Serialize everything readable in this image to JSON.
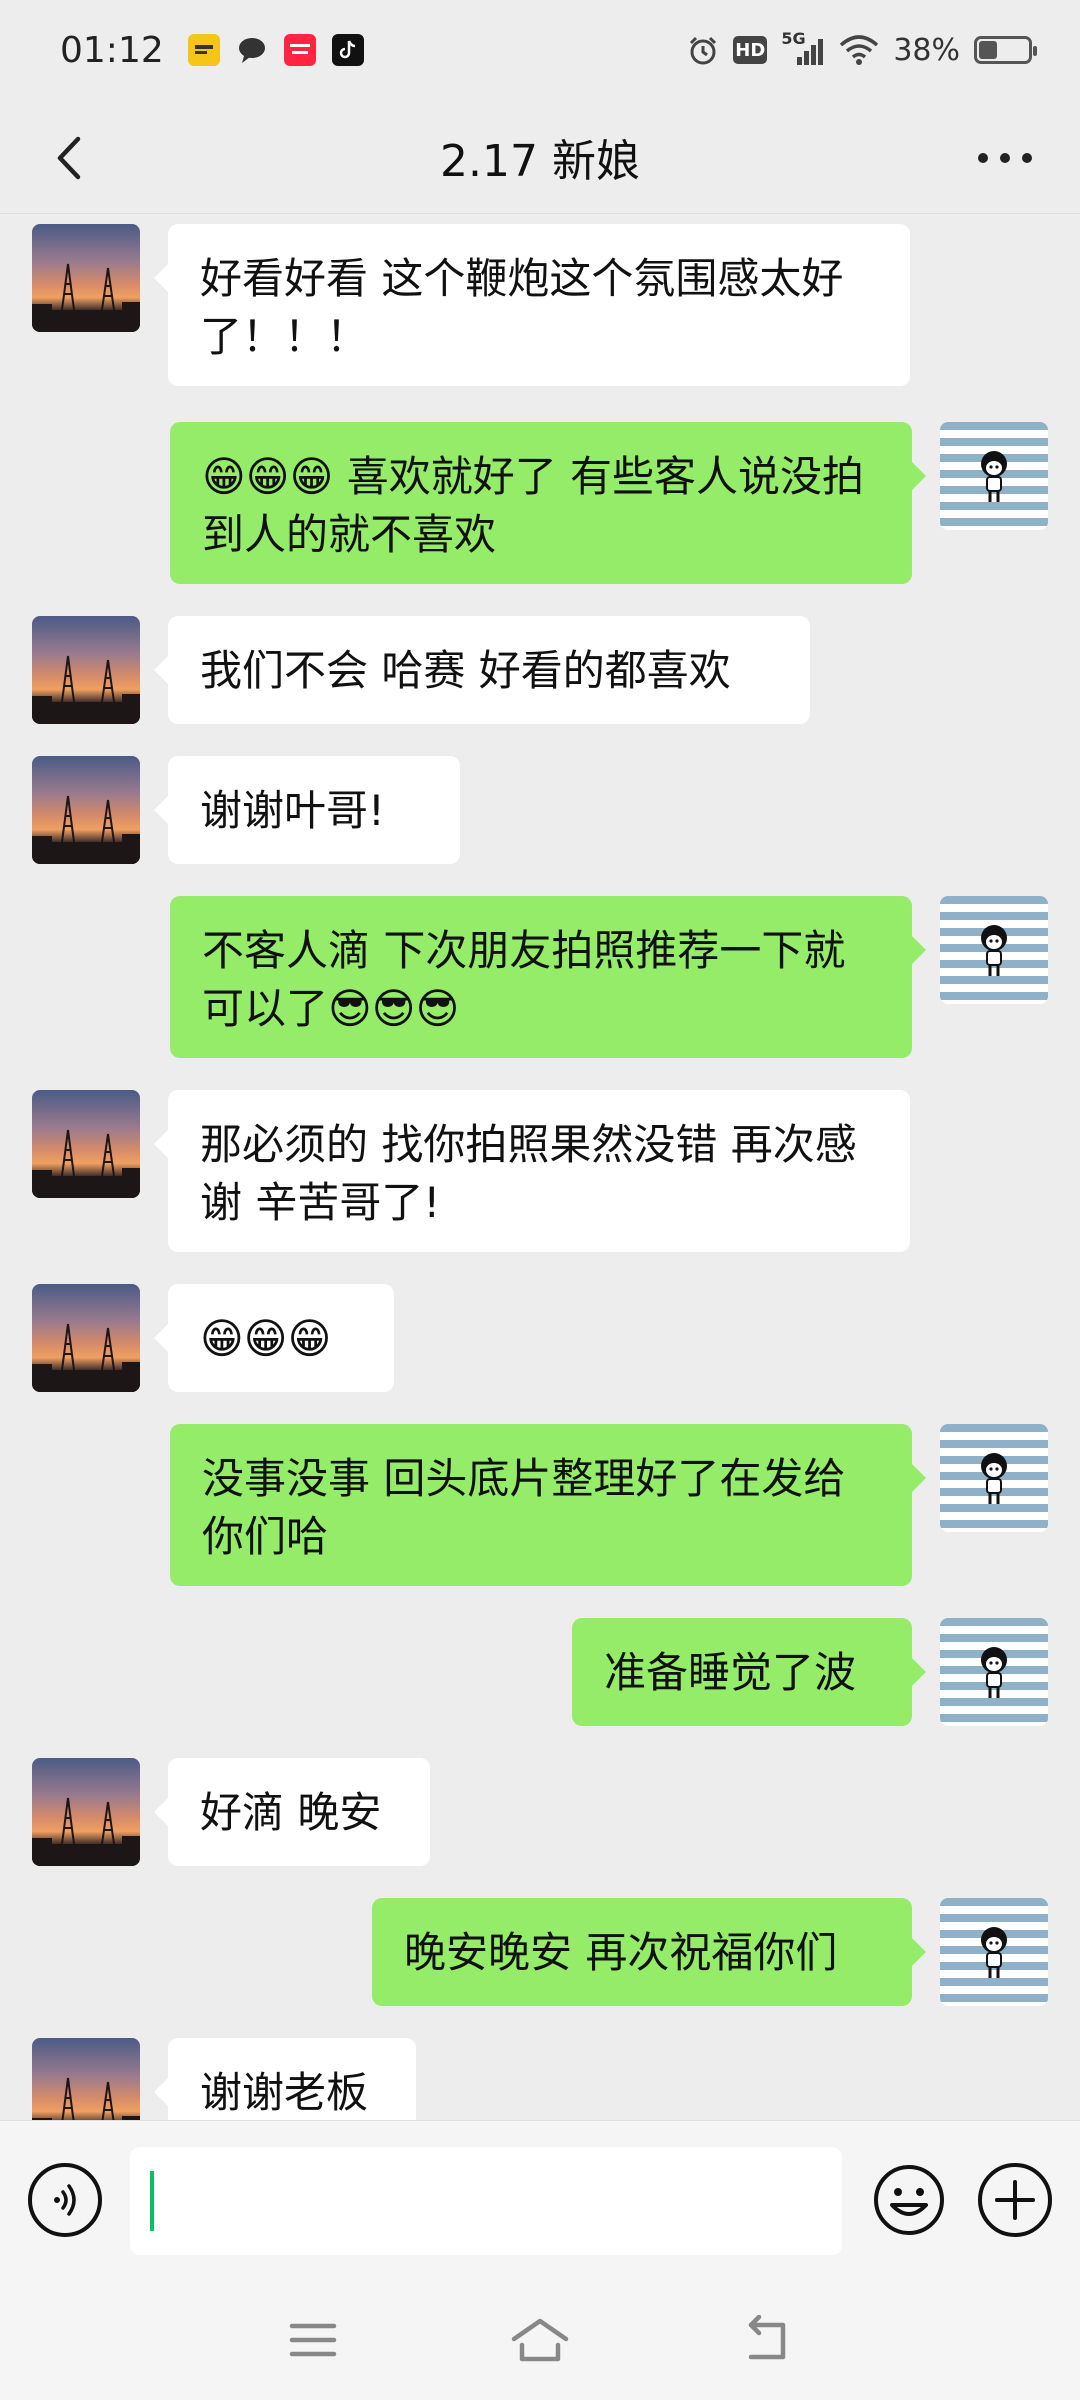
{
  "status_bar": {
    "time": "01:12",
    "network": "5G",
    "hd_label": "HD",
    "battery": "38%",
    "battery_level": 0.38,
    "icons": [
      "app-icon-yellow",
      "message-bubble-icon",
      "redbook-app-icon",
      "tiktok-icon",
      "alarm-icon",
      "hd-icon",
      "signal-icon",
      "wifi-icon",
      "battery-icon"
    ]
  },
  "header": {
    "title": "2.17 新娘",
    "back_icon": "chevron-left-icon",
    "more_icon": "more-dots-icon"
  },
  "colors": {
    "background": "#ededed",
    "incoming_bubble": "#ffffff",
    "outgoing_bubble": "#95ec69",
    "cursor": "#07c160"
  },
  "messages": [
    {
      "side": "in",
      "text": "好看好看 这个鞭炮这个氛围感太好了！！！"
    },
    {
      "side": "out",
      "text": "😁😁😁 喜欢就好了 有些客人说没拍到人的就不喜欢"
    },
    {
      "side": "in",
      "text": "我们不会 哈赛 好看的都喜欢"
    },
    {
      "side": "in",
      "text": "谢谢叶哥!"
    },
    {
      "side": "out",
      "text": "不客人滴 下次朋友拍照推荐一下就可以了😎😎😎"
    },
    {
      "side": "in",
      "text": "那必须的 找你拍照果然没错  再次感谢 辛苦哥了!"
    },
    {
      "side": "in",
      "text": "😁😁😁"
    },
    {
      "side": "out",
      "text": "没事没事 回头底片整理好了在发给你们哈"
    },
    {
      "side": "out",
      "text": "准备睡觉了波"
    },
    {
      "side": "in",
      "text": "好滴 晚安"
    },
    {
      "side": "out",
      "text": "晚安晚安 再次祝福你们"
    },
    {
      "side": "in",
      "text": "谢谢老板"
    }
  ],
  "input_bar": {
    "value": "",
    "voice_icon": "voice-icon",
    "emoji_icon": "emoji-icon",
    "plus_icon": "plus-icon"
  },
  "nav_bar": {
    "icons": [
      "menu-icon",
      "home-icon",
      "back-icon"
    ]
  }
}
